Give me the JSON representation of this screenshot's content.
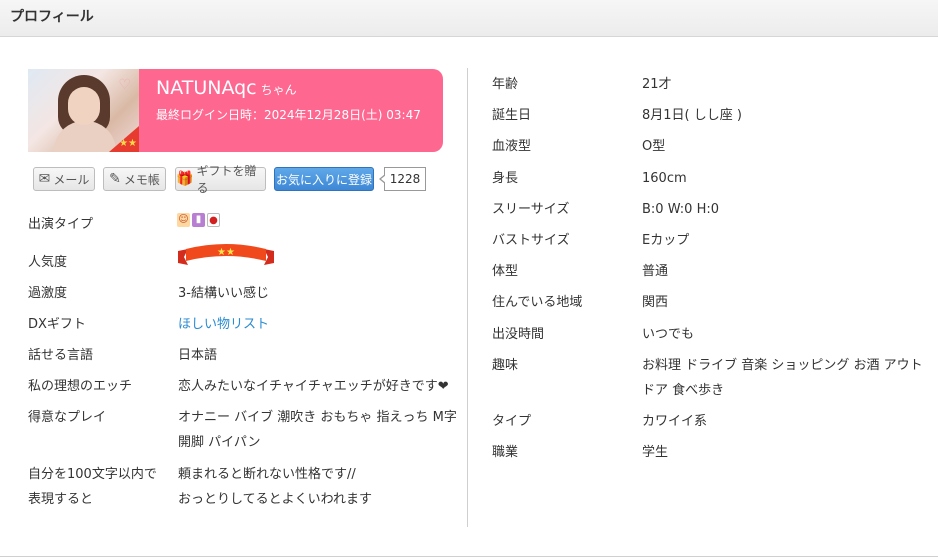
{
  "header": {
    "title": "プロフィール"
  },
  "profile": {
    "name": "NATUNAqc",
    "name_suffix": "ちゃん",
    "last_login": "最終ログイン日時：2024年12月28日(土) 03:47",
    "favorite_count": "1228"
  },
  "buttons": {
    "mail": "メール",
    "memo": "メモ帳",
    "gift": "ギフトを贈る",
    "favorite": "お気に入りに登録"
  },
  "left_rows": [
    {
      "label": "出演タイプ",
      "value": ""
    },
    {
      "label": "人気度",
      "value": ""
    },
    {
      "label": "過激度",
      "value": "3-結構いい感じ"
    },
    {
      "label": "DXギフト",
      "value": "ほしい物リスト"
    },
    {
      "label": "話せる言語",
      "value": "日本語"
    },
    {
      "label": "私の理想のエッチ",
      "value": "恋人みたいなイチャイチャエッチが好きです❤"
    },
    {
      "label": "得意なプレイ",
      "value": "オナニー バイブ 潮吹き おもちゃ 指えっち M字",
      "value2": "開脚 パイパン"
    },
    {
      "label": "自分を100文字以内で",
      "label2": "表現すると",
      "value": "頼まれると断れない性格です//",
      "value2": "おっとりしてるとよくいわれます"
    }
  ],
  "right_rows": [
    {
      "label": "年齢",
      "value": "21才"
    },
    {
      "label": "誕生日",
      "value": "8月1日( しし座 )"
    },
    {
      "label": "血液型",
      "value": "O型"
    },
    {
      "label": "身長",
      "value": "160cm"
    },
    {
      "label": "スリーサイズ",
      "value": "B:0 W:0 H:0"
    },
    {
      "label": "バストサイズ",
      "value": "Eカップ"
    },
    {
      "label": "体型",
      "value": "普通"
    },
    {
      "label": "住んでいる地域",
      "value": "関西"
    },
    {
      "label": "出没時間",
      "value": "いつでも"
    },
    {
      "label": "趣味",
      "value": "お料理 ドライブ 音楽 ショッピング お酒 アウト",
      "value2": "ドア 食べ歩き"
    },
    {
      "label": "タイプ",
      "value": "カワイイ系"
    },
    {
      "label": "職業",
      "value": "学生"
    }
  ],
  "icons": {
    "appearance": [
      "face-icon",
      "toy-icon",
      "japan-flag-icon"
    ],
    "popularity": "ribbon-two-stars-icon",
    "mail": "envelope-icon",
    "memo": "notepad-icon",
    "gift": "gift-icon"
  },
  "colors": {
    "name_card": "#fe6790",
    "favorite_button": "#3d87d6",
    "link": "#2a8bd2"
  }
}
